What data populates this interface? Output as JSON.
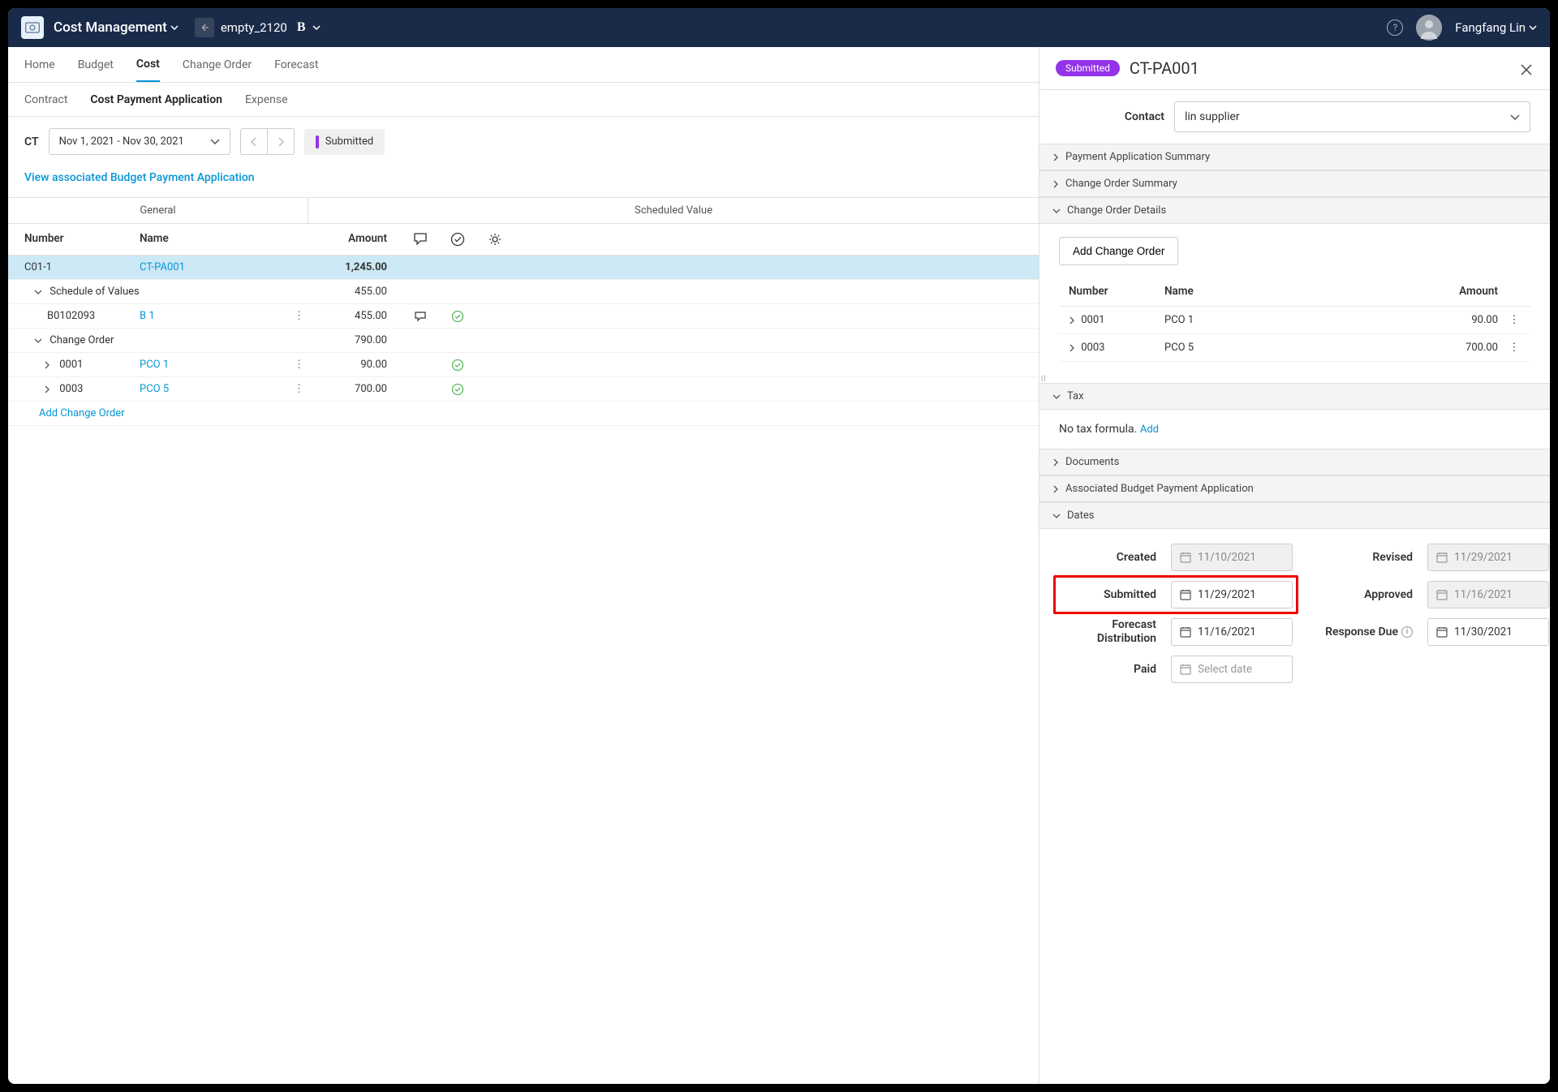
{
  "topbar": {
    "app_name": "Cost Management",
    "project_name": "empty_2120",
    "username": "Fangfang Lin"
  },
  "nav_tabs": [
    "Home",
    "Budget",
    "Cost",
    "Change Order",
    "Forecast"
  ],
  "sub_tabs": [
    "Contract",
    "Cost Payment Application",
    "Expense"
  ],
  "filter": {
    "ct_label": "CT",
    "date_range": "Nov 1, 2021 - Nov 30, 2021",
    "status": "Submitted"
  },
  "view_link": "View associated Budget Payment Application",
  "table": {
    "group_general": "General",
    "group_sched": "Scheduled Value",
    "col_number": "Number",
    "col_name": "Name",
    "col_amount": "Amount",
    "rows": [
      {
        "number": "C01-1",
        "name": "CT-PA001",
        "amount": "1,245.00",
        "selected": true,
        "linked": true
      },
      {
        "number": "Schedule of Values",
        "amount": "455.00",
        "type": "group",
        "indent": 1
      },
      {
        "number": "B0102093",
        "name": "B 1",
        "amount": "455.00",
        "indent": 2,
        "linked": true,
        "more": true,
        "comment": true,
        "check": true
      },
      {
        "number": "Change Order",
        "amount": "790.00",
        "type": "group",
        "indent": 1
      },
      {
        "number": "0001",
        "name": "PCO 1",
        "amount": "90.00",
        "indent": 2,
        "linked": true,
        "more": true,
        "check": true,
        "chev": true
      },
      {
        "number": "0003",
        "name": "PCO 5",
        "amount": "700.00",
        "indent": 2,
        "linked": true,
        "more": true,
        "check": true,
        "chev": true
      }
    ],
    "add_co": "Add Change Order"
  },
  "pane": {
    "status": "Submitted",
    "title": "CT-PA001",
    "contact_label": "Contact",
    "contact_value": "lin supplier",
    "sections": {
      "pay_summary": "Payment Application Summary",
      "co_summary": "Change Order Summary",
      "co_details": "Change Order Details",
      "tax": "Tax",
      "documents": "Documents",
      "assoc": "Associated Budget Payment Application",
      "dates": "Dates"
    },
    "add_co_btn": "Add Change Order",
    "co_cols": {
      "number": "Number",
      "name": "Name",
      "amount": "Amount"
    },
    "co_rows": [
      {
        "number": "0001",
        "name": "PCO 1",
        "amount": "90.00"
      },
      {
        "number": "0003",
        "name": "PCO 5",
        "amount": "700.00"
      }
    ],
    "tax_text": "No tax formula. ",
    "tax_add": "Add",
    "dates": {
      "created_label": "Created",
      "created_value": "11/10/2021",
      "revised_label": "Revised",
      "revised_value": "11/29/2021",
      "submitted_label": "Submitted",
      "submitted_value": "11/29/2021",
      "approved_label": "Approved",
      "approved_value": "11/16/2021",
      "forecast_label": "Forecast Distribution",
      "forecast_value": "11/16/2021",
      "response_label": "Response Due",
      "response_value": "11/30/2021",
      "paid_label": "Paid",
      "paid_placeholder": "Select date"
    }
  }
}
